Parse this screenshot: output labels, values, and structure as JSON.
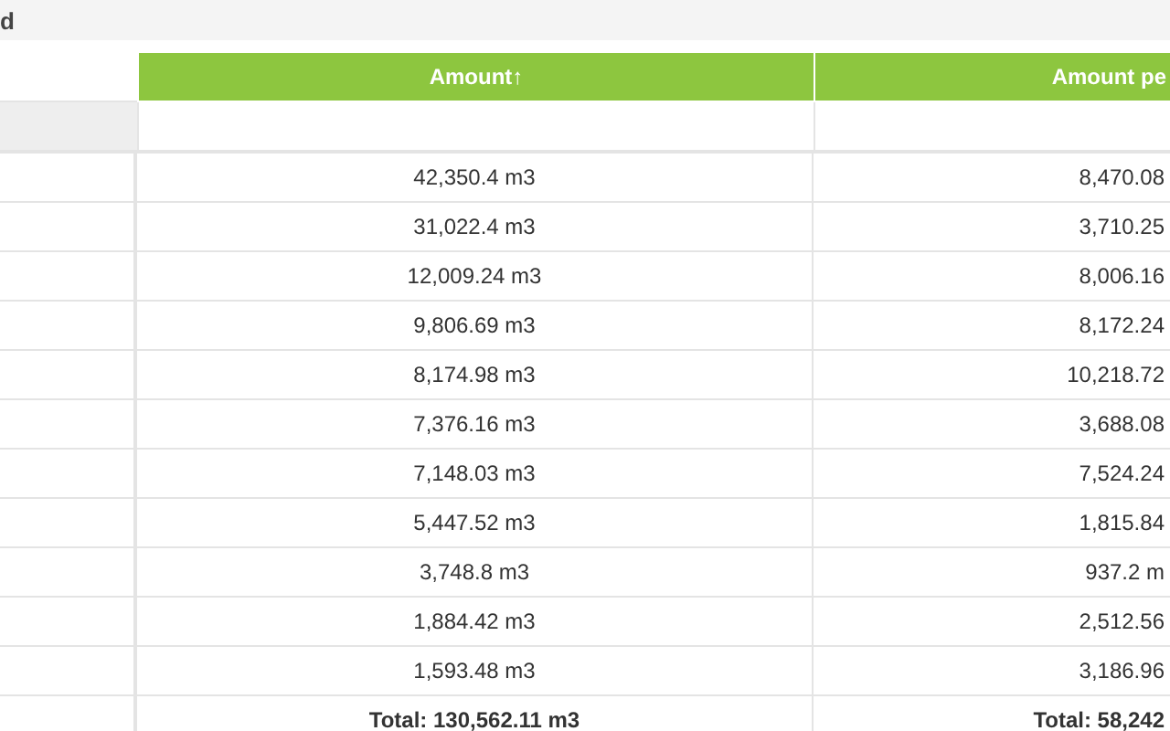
{
  "panel": {
    "title": "d"
  },
  "table": {
    "columns": [
      {},
      {
        "label": "Amount",
        "sort_indicator": "↑"
      },
      {
        "label": "Amount pe"
      }
    ],
    "rows": [
      [
        "",
        "42,350.4 m3",
        "8,470.08"
      ],
      [
        "",
        "31,022.4 m3",
        "3,710.25"
      ],
      [
        "",
        "12,009.24 m3",
        "8,006.16"
      ],
      [
        "",
        "9,806.69 m3",
        "8,172.24"
      ],
      [
        "",
        "8,174.98 m3",
        "10,218.72"
      ],
      [
        "",
        "7,376.16 m3",
        "3,688.08"
      ],
      [
        "",
        "7,148.03 m3",
        "7,524.24"
      ],
      [
        "",
        "5,447.52 m3",
        "1,815.84"
      ],
      [
        "",
        "3,748.8 m3",
        "937.2 m"
      ],
      [
        "",
        "1,884.42 m3",
        "2,512.56"
      ],
      [
        "",
        "1,593.48 m3",
        "3,186.96"
      ]
    ],
    "totals": [
      "Total: 130,562.11 m3",
      "Total: 58,242"
    ]
  }
}
